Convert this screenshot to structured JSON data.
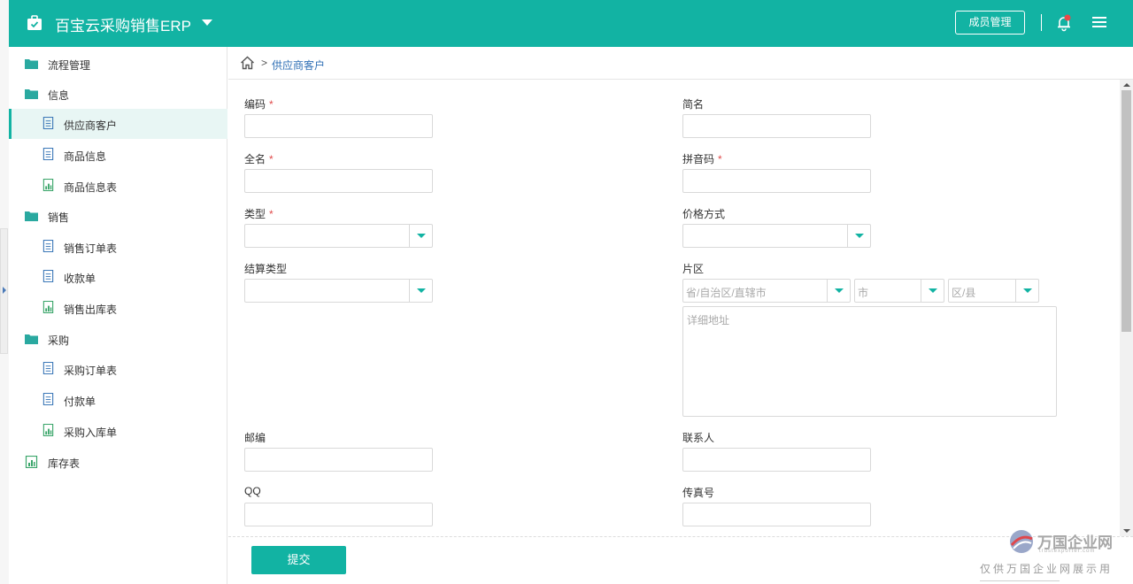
{
  "header": {
    "app_title": "百宝云采购销售ERP",
    "member_button": "成员管理"
  },
  "colors": {
    "brand": "#12b3a3",
    "link": "#2f6fb5",
    "required": "#e04b4b"
  },
  "sidebar": {
    "items": [
      {
        "label": "流程管理",
        "icon": "folder-icon",
        "level": "group"
      },
      {
        "label": "信息",
        "icon": "folder-icon",
        "level": "group"
      },
      {
        "label": "供应商客户",
        "icon": "document-icon",
        "level": "sub",
        "active": true
      },
      {
        "label": "商品信息",
        "icon": "document-icon",
        "level": "sub"
      },
      {
        "label": "商品信息表",
        "icon": "report-icon",
        "level": "sub"
      },
      {
        "label": "销售",
        "icon": "folder-icon",
        "level": "group"
      },
      {
        "label": "销售订单表",
        "icon": "document-icon",
        "level": "sub"
      },
      {
        "label": "收款单",
        "icon": "document-icon",
        "level": "sub"
      },
      {
        "label": "销售出库表",
        "icon": "report-icon",
        "level": "sub"
      },
      {
        "label": "采购",
        "icon": "folder-icon",
        "level": "group"
      },
      {
        "label": "采购订单表",
        "icon": "document-icon",
        "level": "sub"
      },
      {
        "label": "付款单",
        "icon": "document-icon",
        "level": "sub"
      },
      {
        "label": "采购入库单",
        "icon": "report-icon",
        "level": "sub"
      },
      {
        "label": "库存表",
        "icon": "report-icon",
        "level": "group"
      }
    ]
  },
  "breadcrumb": {
    "separator": ">",
    "current": "供应商客户"
  },
  "form": {
    "code": {
      "label": "编码",
      "required": "*",
      "value": ""
    },
    "short_name": {
      "label": "简名",
      "value": ""
    },
    "full_name": {
      "label": "全名",
      "required": "*",
      "value": ""
    },
    "pinyin": {
      "label": "拼音码",
      "required": "*",
      "value": ""
    },
    "type": {
      "label": "类型",
      "required": "*",
      "selected": ""
    },
    "price_mode": {
      "label": "价格方式",
      "selected": ""
    },
    "settlement_type": {
      "label": "结算类型",
      "selected": ""
    },
    "region": {
      "label": "片区",
      "province_placeholder": "省/自治区/直辖市",
      "city_placeholder": "市",
      "district_placeholder": "区/县",
      "address_placeholder": "详细地址"
    },
    "postcode": {
      "label": "邮编",
      "value": ""
    },
    "contact": {
      "label": "联系人",
      "value": ""
    },
    "qq": {
      "label": "QQ",
      "value": ""
    },
    "fax": {
      "label": "传真号",
      "value": ""
    }
  },
  "footer": {
    "submit_label": "提交"
  },
  "watermark": {
    "name": "万国企业网",
    "url": "trustexporter.com",
    "note": "仅供万国企业网展示用"
  }
}
